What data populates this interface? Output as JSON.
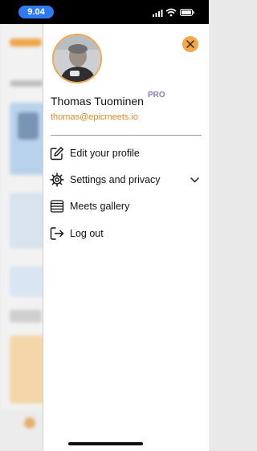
{
  "status_bar": {
    "time": "9.04"
  },
  "drawer": {
    "user": {
      "name": "Thomas Tuominen",
      "badge": "PRO",
      "email": "thomas@epicmeets.io"
    },
    "menu": [
      {
        "label": "Edit your profile",
        "icon": "edit-icon"
      },
      {
        "label": "Settings and privacy",
        "icon": "gear-icon",
        "expandable": true
      },
      {
        "label": "Meets gallery",
        "icon": "gallery-icon"
      },
      {
        "label": "Log out",
        "icon": "logout-icon"
      }
    ]
  },
  "colors": {
    "accent": "#f5a64a",
    "email": "#e4892a",
    "pro_badge": "#8f7ab8",
    "time_pill": "#2f7bf6"
  }
}
